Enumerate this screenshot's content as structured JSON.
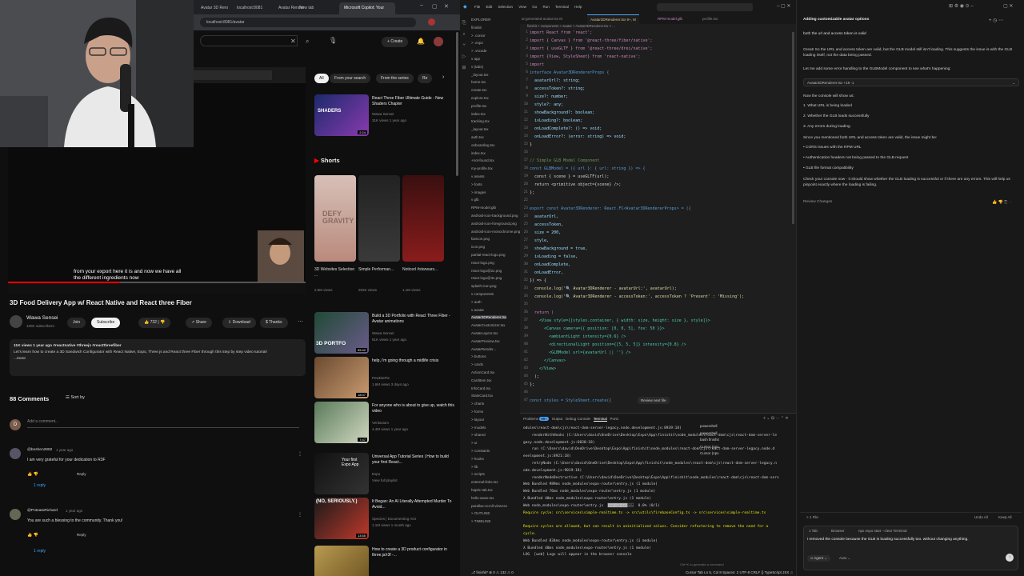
{
  "browser": {
    "tabs": [
      "Avatar 3D Render",
      "localhost:8081",
      "Avatar Render",
      "New tab",
      "Microsoft Copilot: Your"
    ],
    "address": "localhost:8081/avatar",
    "youtube": {
      "create_label": "Create",
      "player_caption": "from your export here it is and now we have all the different ingredients now",
      "video_title": "3D Food Delivery App w/ React Native and React three Fiber",
      "channel_name": "Wawa Sensei",
      "subscribers": "100K subscribers",
      "join_label": "Join",
      "subscribe_label": "Subscribe",
      "likes": "732",
      "share_label": "Share",
      "download_label": "Download",
      "thanks_label": "Thanks",
      "description_line1": "11K views  1 year ago  #reactnative #threejs #reactthreefiber",
      "description_line2": "Let's learn how to create a 3D Sandwich Configurator with React Native, Expo, Three.js and React three Fiber through this step by step video tutorial!",
      "description_more": "...more",
      "comments_heading": "88 Comments",
      "sort_label": "Sort by",
      "add_comment_placeholder": "Add a comment...",
      "comments": [
        {
          "author": "@boshen2882",
          "time": "1 year ago",
          "text": "I am very grateful for your dedication to R3F",
          "replies": "1 reply"
        },
        {
          "author": "@PoteatoRichard",
          "time": "1 year ago",
          "text": "You are such a blessing to the community. Thank you!",
          "replies": "1 reply"
        }
      ],
      "chips": [
        "All",
        "From your search",
        "From the series",
        "Re"
      ],
      "shorts_heading": "Shorts",
      "shorts": [
        {
          "title": "3D Websites Selection ...",
          "views": "2.6M views"
        },
        {
          "title": "Simple Performan...",
          "views": "202K views"
        },
        {
          "title": "Noticed #starwars...",
          "views": "1.1M views"
        }
      ],
      "recommendations": [
        {
          "title": "React Three Fiber Ultimate Guide - New Shaders Chapter",
          "channel": "Wawa Sensei",
          "meta": "31K views  1 year ago",
          "duration": "2:24",
          "thumb": "SHADERS"
        },
        {
          "title": "Build a 3D Portfolio with React Three Fiber - Avatar animations",
          "channel": "Wawa Sensei",
          "meta": "81K views  1 year ago",
          "duration": "55:42",
          "thumb": "3D PORTFO"
        },
        {
          "title": "help, i'm going through a midlife crisis",
          "channel": "PewDiePie",
          "meta": "1.6M views  3 days ago",
          "duration": "18:07",
          "thumb": ""
        },
        {
          "title": "For anyone who is about to give up, watch this video",
          "channel": "Veritasium",
          "meta": "4.4M views  1 year ago",
          "duration": "7:47",
          "thumb": ""
        },
        {
          "title": "Universal App Tutorial Series | How to build your first React...",
          "channel": "Expo",
          "meta": "View full playlist",
          "duration": "",
          "thumb": "Your first Expo App"
        },
        {
          "title": "It Began: An AI Literally Attempted Murder To Avoid...",
          "channel": "Species | Documenting AGI",
          "meta": "1.1M views  1 month ago",
          "duration": "13:55",
          "thumb": "(NO, SERIOUSLY.)"
        },
        {
          "title": "How to create a 3D product configurator in three.js/r3f -...",
          "channel": "",
          "meta": "",
          "duration": "",
          "thumb": ""
        }
      ]
    }
  },
  "vscode": {
    "tabs": [
      "ai-generated-avatar.tsx M",
      "Avatar3DRenderer.tsx 9+, M",
      "RPM-model.glb",
      "profile.tsx"
    ],
    "breadcrumb": "finishit > components > avatar > Avatar3DRenderer.tsx > ...",
    "explorer_items": [
      "EXPLORER",
      "finishit",
      "> .cursor",
      "> .expo",
      "> .vscode",
      "v app",
      "  v (tabs)",
      "    _layout.tsx",
      "    home.tsx",
      "    create.tsx",
      "    explore.tsx",
      "    profile.tsx",
      "    index.tsx",
      "    tracking.tsx",
      "  _layout.tsx",
      "  auth.tsx",
      "  onboarding.tsx",
      "  index.tsx",
      "  +not-found.tsx",
      "  my-profile.tsx",
      "v assets",
      "  > fonts",
      "  > images",
      "  v glb",
      "    RPM-model.glb",
      "    android-icon-background.png",
      "    android-icon-foreground.png",
      "    android-icon-monochrome.png",
      "    favicon.png",
      "    icon.png",
      "    partial-react-logo.png",
      "    react-logo.png",
      "    react-logo@2x.png",
      "    react-logo@3x.png",
      "    splash-icon.png",
      "v components",
      "  > auth",
      "  v avatar",
      "    Avatar3DRenderer.tsx",
      "    AvatarCustomizer.tsx",
      "    AvatarLayers.tsx",
      "    AvatarPreview.tsx",
      "    AvatarRender...",
      "  > buttons",
      "  > cards",
      "    ActionCard.tsx",
      "    CardItem.tsx",
      "    InfoCard.tsx",
      "    StatsCard.tsx",
      "  > charts",
      "  > forms",
      "  > layout",
      "  > models",
      "  > shared",
      "  > ui",
      "> constants",
      "> hooks",
      "> lib",
      "> scripts",
      "  external-links.tsx",
      "  haptic-tab.tsx",
      "  hello-wave.tsx",
      "  parallax-scroll-view.tsx",
      "> OUTLINE",
      "> TIMELINE"
    ],
    "code_lines": [
      {
        "n": "1",
        "t": "import React from 'react';",
        "c": "#c586c0"
      },
      {
        "n": "2",
        "t": "import { Canvas } from '@react-three/fiber/native';",
        "c": "#c586c0"
      },
      {
        "n": "3",
        "t": "import { useGLTF } from '@react-three/drei/native';",
        "c": "#c586c0"
      },
      {
        "n": "4",
        "t": "import {View, StyleSheet} from 'react-native';",
        "c": "#c586c0"
      },
      {
        "n": "5",
        "t": "import ",
        "c": "#c586c0"
      },
      {
        "n": "6",
        "t": "interface Avatar3DRendererProps {",
        "c": "#569cd6"
      },
      {
        "n": "7",
        "t": "  avatarUrl?: string;",
        "c": "#9cdcfe"
      },
      {
        "n": "8",
        "t": "  accessToken?: string;",
        "c": "#9cdcfe"
      },
      {
        "n": "9",
        "t": "  size?: number;",
        "c": "#9cdcfe"
      },
      {
        "n": "10",
        "t": "  style?: any;",
        "c": "#9cdcfe"
      },
      {
        "n": "11",
        "t": "  showBackground?: boolean;",
        "c": "#9cdcfe"
      },
      {
        "n": "12",
        "t": "  isLoading?: boolean;",
        "c": "#9cdcfe"
      },
      {
        "n": "13",
        "t": "  onLoadComplete?: () => void;",
        "c": "#9cdcfe"
      },
      {
        "n": "14",
        "t": "  onLoadError?: (error: string) => void;",
        "c": "#9cdcfe"
      },
      {
        "n": "15",
        "t": "}",
        "c": "#d4d4d4"
      },
      {
        "n": "16",
        "t": "",
        "c": "#d4d4d4"
      },
      {
        "n": "17",
        "t": "// Simple GLB Model Component",
        "c": "#6a9955"
      },
      {
        "n": "18",
        "t": "const GLBModel = ({ url }: { url: string }) => {",
        "c": "#569cd6"
      },
      {
        "n": "19",
        "t": "  const { scene } = useGLTF(url);",
        "c": "#d4d4d4"
      },
      {
        "n": "20",
        "t": "  return <primitive object={scene} />;",
        "c": "#d4d4d4"
      },
      {
        "n": "21",
        "t": "};",
        "c": "#d4d4d4"
      },
      {
        "n": "22",
        "t": "",
        "c": "#d4d4d4"
      },
      {
        "n": "23",
        "t": "export const Avatar3DRenderer: React.FC<Avatar3DRendererProps> = ({",
        "c": "#569cd6"
      },
      {
        "n": "24",
        "t": "  avatarUrl,",
        "c": "#9cdcfe"
      },
      {
        "n": "25",
        "t": "  accessToken,",
        "c": "#9cdcfe"
      },
      {
        "n": "26",
        "t": "  size = 200,",
        "c": "#9cdcfe"
      },
      {
        "n": "27",
        "t": "  style,",
        "c": "#9cdcfe"
      },
      {
        "n": "28",
        "t": "  showBackground = true,",
        "c": "#9cdcfe"
      },
      {
        "n": "29",
        "t": "  isLoading = false,",
        "c": "#9cdcfe"
      },
      {
        "n": "30",
        "t": "  onLoadComplete,",
        "c": "#9cdcfe"
      },
      {
        "n": "31",
        "t": "  onLoadError,",
        "c": "#9cdcfe"
      },
      {
        "n": "32",
        "t": "}) => {",
        "c": "#d4d4d4"
      },
      {
        "n": "33",
        "t": "  console.log('🔍 Avatar3DRenderer - avatarUrl:', avatarUrl);",
        "c": "#dcdcaa"
      },
      {
        "n": "34",
        "t": "  console.log('🔍 Avatar3DRenderer - accessToken:', accessToken ? 'Present' : 'Missing');",
        "c": "#dcdcaa"
      },
      {
        "n": "35",
        "t": "",
        "c": "#d4d4d4"
      },
      {
        "n": "36",
        "t": "  return (",
        "c": "#c586c0"
      },
      {
        "n": "37",
        "t": "    <View style={[styles.container, { width: size, height: size }, style]}>",
        "c": "#4ec9b0"
      },
      {
        "n": "38",
        "t": "      <Canvas camera={{ position: [0, 0, 5], fov: 50 }}>",
        "c": "#4ec9b0"
      },
      {
        "n": "39",
        "t": "        <ambientLight intensity={0.6} />",
        "c": "#4ec9b0"
      },
      {
        "n": "40",
        "t": "        <directionalLight position={[5, 5, 5]} intensity={0.8} />",
        "c": "#4ec9b0"
      },
      {
        "n": "41",
        "t": "        <GLBModel url={avatarUrl || ''} />",
        "c": "#4ec9b0"
      },
      {
        "n": "42",
        "t": "      </Canvas>",
        "c": "#4ec9b0"
      },
      {
        "n": "43",
        "t": "    </View>",
        "c": "#4ec9b0"
      },
      {
        "n": "44",
        "t": "  );",
        "c": "#d4d4d4"
      },
      {
        "n": "45",
        "t": "};",
        "c": "#d4d4d4"
      },
      {
        "n": "46",
        "t": "",
        "c": "#d4d4d4"
      },
      {
        "n": "47",
        "t": "const styles = StyleSheet.create({",
        "c": "#569cd6"
      }
    ],
    "review_hint": "Review next file",
    "panel_tabs": [
      "Problems",
      "Output",
      "Debug Console",
      "Terminal",
      "Ports"
    ],
    "problems_count": "99+",
    "terminal_lines": [
      {
        "t": "odules\\react-dom\\cjs\\react-dom-server-legacy.node.development.js:8939:18)",
        "c": "#ccc"
      },
      {
        "t": "    renderWithHooks (C:\\Users\\david\\OneDrive\\Desktop\\Expo\\App\\finishit\\node_modules\\react-dom\\cjs\\react-dom-server-le",
        "c": "#ccc"
      },
      {
        "t": "gacy.node.development.js:6030:18)",
        "c": "#ccc"
      },
      {
        "t": "    run (C:\\Users\\david\\OneDrive\\Desktop\\Expo\\App\\finishit\\node_modules\\react-dom\\cjs\\react-dom-server-legacy.node.d",
        "c": "#ccc"
      },
      {
        "t": "evelopment.js:8921:18)",
        "c": "#ccc"
      },
      {
        "t": "    retryNode (C:\\Users\\david\\OneDrive\\Desktop\\Expo\\App\\finishit\\node_modules\\react-dom\\cjs\\react-dom-server-legacy.n",
        "c": "#ccc"
      },
      {
        "t": "ode.development.js:9019:18)",
        "c": "#ccc"
      },
      {
        "t": "    renderNodeDestructive (C:\\Users\\david\\OneDrive\\Desktop\\Expo\\App\\finishit\\node_modules\\react-dom\\cjs\\react-dom-serv",
        "c": "#ccc"
      },
      {
        "t": "Web Bundled 989ms node_modules\\expo-router\\entry.js (1 module)",
        "c": "#ccc"
      },
      {
        "t": "Web Bundled 76ms node_modules\\expo-router\\entry.js (1 module)",
        "c": "#ccc"
      },
      {
        "t": "λ Bundled 40ms node_modules\\expo-router\\entry.js (1 module)",
        "c": "#ccc"
      },
      {
        "t": "Web node_modules\\expo-router\\entry.js  ▓▓▓▓▓▓▓▓▓░░░  0.0% (0/1)",
        "c": "#ccc"
      },
      {
        "t": "Require cycle: src\\services\\simple-realtime.ts -> src\\utils\\firebaseConfig.ts -> src\\services\\simple-realtime.ts",
        "c": "#e5e510"
      },
      {
        "t": "",
        "c": "#ccc"
      },
      {
        "t": "Require cycles are allowed, but can result in uninitialized values. Consider refactoring to remove the need for a",
        "c": "#e5e510"
      },
      {
        "t": "cycle.",
        "c": "#e5e510"
      },
      {
        "t": "Web Bundled 834ms node_modules\\expo-router\\entry.js (1 module)",
        "c": "#ccc"
      },
      {
        "t": "λ Bundled 40ms node_modules\\expo-router\\entry.js (1 module)",
        "c": "#ccc"
      },
      {
        "t": "LOG  [web] Logs will appear in the browser console",
        "c": "#ccc"
      }
    ],
    "terminal_sessions": [
      "powershell",
      "powershell",
      "bash finishit",
      "Cursor (npx",
      "Cursor (npx"
    ],
    "terminal_hint": "Ctrl+K to generate a command",
    "status_left": "⎇ finishit*  ⊗ 0 ⚠ 132 ⚠ 0",
    "status_right": "Cursor Tab  Ln 5, Col 8  Spaces: 2  UTF-8  CRLF  {} TypeScript JSX  ♫"
  },
  "chat": {
    "title": "Adding customizable avatar options",
    "user_msg": "both the url and access token is valid",
    "p1": "Great! So the URL and access token are valid, but the GLB model still isn't loading. This suggests the issue is with the GLB loading itself, not the data being passed.",
    "p2": "Let me add some error handling to the GLBModel component to see what's happening:",
    "file_chip": "Avatar3DRenderer.tsx  +18 -1",
    "p3": "Now the console will show us:",
    "list1": [
      "1. What URL is being loaded",
      "2. Whether the GLB loads successfully",
      "3. Any errors during loading"
    ],
    "p4": "Since you mentioned both URL and access token are valid, the issue might be:",
    "list2": [
      "• CORS issues with the RPM URL",
      "• Authentication headers not being passed to the GLB request",
      "• GLB file format compatibility"
    ],
    "p5": "Check your console now - it should show whether the GLB loading is successful or if there are any errors. This will help us pinpoint exactly where the loading is failing.",
    "review_label": "Review Changes",
    "files_label": "> 1 File",
    "undo_all": "Undo All",
    "keep_all": "Keep All",
    "bottom_tabs": [
      "1 Tab",
      "Browser",
      "npx expo start --clear Terminal"
    ],
    "input_text": "i removed the console because the GLB is loading successfully too. without changing anything.",
    "mode": "Agent",
    "model": "Auto",
    "ctrl_hint": "Ctrl+L"
  }
}
